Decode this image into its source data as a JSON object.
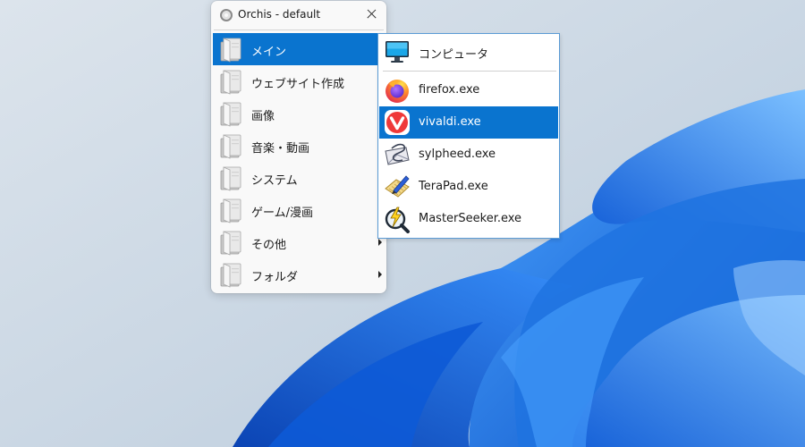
{
  "window": {
    "title": "Orchis - default"
  },
  "menu": {
    "items": [
      {
        "label": "メイン",
        "selected": true,
        "has_submenu": false,
        "icon": "folder-icon"
      },
      {
        "label": "ウェブサイト作成",
        "selected": false,
        "has_submenu": false,
        "icon": "folder-icon"
      },
      {
        "label": "画像",
        "selected": false,
        "has_submenu": false,
        "icon": "folder-icon"
      },
      {
        "label": "音楽・動画",
        "selected": false,
        "has_submenu": false,
        "icon": "folder-icon"
      },
      {
        "label": "システム",
        "selected": false,
        "has_submenu": false,
        "icon": "folder-icon"
      },
      {
        "label": "ゲーム/漫画",
        "selected": false,
        "has_submenu": false,
        "icon": "folder-icon"
      },
      {
        "label": "その他",
        "selected": false,
        "has_submenu": true,
        "icon": "folder-icon"
      },
      {
        "label": "フォルダ",
        "selected": false,
        "has_submenu": true,
        "icon": "folder-icon"
      }
    ]
  },
  "submenu": {
    "header": {
      "label": "コンピュータ",
      "icon": "monitor-icon"
    },
    "items": [
      {
        "label": "firefox.exe",
        "icon": "firefox-icon",
        "selected": false
      },
      {
        "label": "vivaldi.exe",
        "icon": "vivaldi-icon",
        "selected": true
      },
      {
        "label": "sylpheed.exe",
        "icon": "sylpheed-icon",
        "selected": false
      },
      {
        "label": "TeraPad.exe",
        "icon": "terapad-icon",
        "selected": false
      },
      {
        "label": "MasterSeeker.exe",
        "icon": "masterseeker-icon",
        "selected": false
      }
    ]
  },
  "colors": {
    "selection": "#0a74cf",
    "submenu_border": "#5b9bd5",
    "desktop_background": "#cfdae6",
    "wallpaper_bloom": "#1e73e0"
  }
}
